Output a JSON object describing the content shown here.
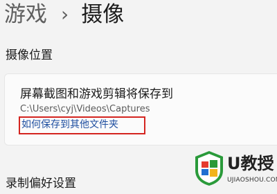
{
  "header": {
    "parent": "游戏",
    "separator": "›",
    "current": "摄像"
  },
  "capture_location": {
    "section_title": "摄像位置",
    "card_title": "屏幕截图和游戏剪辑将保存到",
    "path": "C:\\Users\\cyj\\Videos\\Captures",
    "link_text": "如何保存到其他文件夹",
    "highlight_color": "#d4241f",
    "link_color": "#1f4fa0"
  },
  "recording_preferences": {
    "section_title": "录制偏好设置"
  },
  "watermark": {
    "brand": "U教授",
    "url": "UJIAOSHOU.COM",
    "logo_icon": "green-shield-windows-icon"
  }
}
